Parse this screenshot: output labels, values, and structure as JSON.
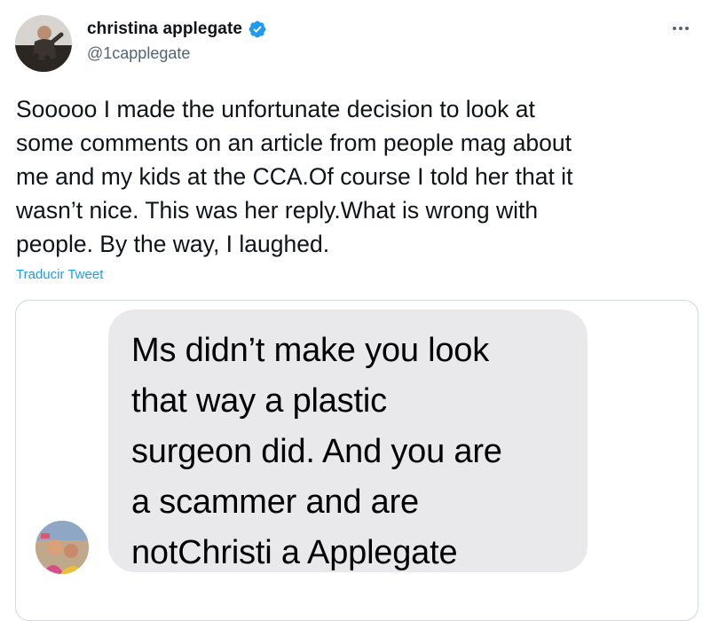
{
  "tweet": {
    "display_name": "christina applegate",
    "handle": "@1capplegate",
    "text": "Sooooo I made the unfortunate decision to look at\nsome comments on an article from people mag about\nme and my kids at the CCA.Of course I told her that it\nwasn’t nice. This was her reply.What is wrong with\npeople. By the way, I laughed.",
    "translate_label": "Traducir Tweet"
  },
  "media": {
    "message_text": "Ms didn’t make you look\nthat way a plastic\nsurgeon did. And you are\na scammer and are\nnotChristi a Applegate"
  },
  "icons": {
    "verified": "verified-badge-icon",
    "more": "more-options-icon"
  },
  "colors": {
    "accent": "#1d9bf0",
    "text_primary": "#0f1419",
    "text_secondary": "#536471",
    "bubble": "#e9e9eb",
    "border": "#cfd9de"
  }
}
